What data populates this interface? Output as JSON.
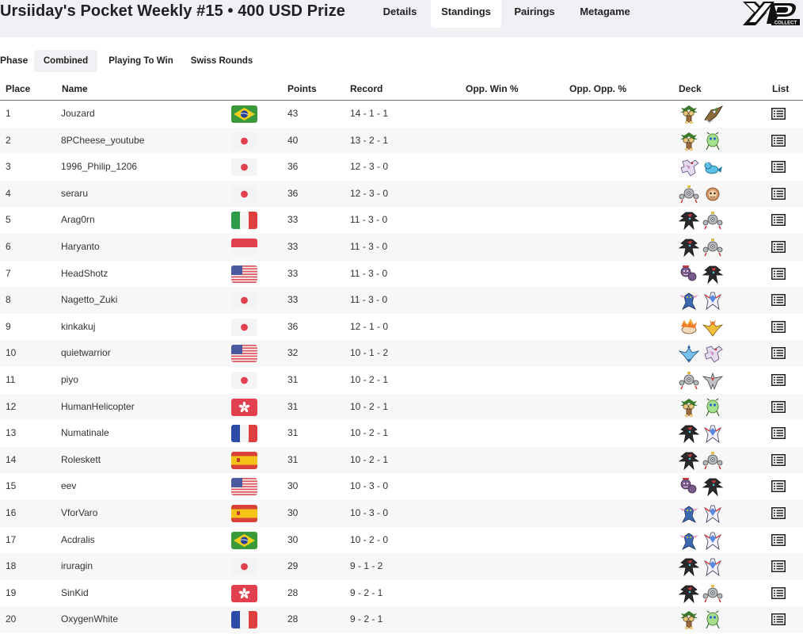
{
  "header": {
    "title": "Ursiiday's Pocket Weekly #15 • 400 USD Prize",
    "tabs": [
      {
        "label": "Details",
        "active": false
      },
      {
        "label": "Standings",
        "active": true
      },
      {
        "label": "Pairings",
        "active": false
      },
      {
        "label": "Metagame",
        "active": false
      }
    ],
    "logo_icon": "xp-collect-logo"
  },
  "phase": {
    "label": "Phase",
    "tabs": [
      {
        "label": "Combined",
        "active": true
      },
      {
        "label": "Playing To Win",
        "active": false
      },
      {
        "label": "Swiss Rounds",
        "active": false
      }
    ]
  },
  "table": {
    "columns": [
      "Place",
      "Name",
      "Points",
      "Record",
      "Opp. Win %",
      "Opp. Opp. %",
      "Deck",
      "List"
    ],
    "rows": [
      {
        "place": "1",
        "name": "Jouzard",
        "flag": "brazil",
        "points": "43",
        "record": "14 - 1 - 1",
        "deck": [
          "exeggutor-icon",
          "decidueye-icon"
        ]
      },
      {
        "place": "2",
        "name": "8PCheese_youtube",
        "flag": "japan",
        "points": "40",
        "record": "13 - 2 - 1",
        "deck": [
          "exeggutor-icon",
          "celebi-icon"
        ]
      },
      {
        "place": "3",
        "name": "1996_Philip_1206",
        "flag": "japan",
        "points": "36",
        "record": "12 - 3 - 0",
        "deck": [
          "palkia-icon",
          "vaporeon-icon"
        ]
      },
      {
        "place": "4",
        "name": "seraru",
        "flag": "japan",
        "points": "36",
        "record": "12 - 3 - 0",
        "deck": [
          "magnezone-icon",
          "primeape-icon"
        ]
      },
      {
        "place": "5",
        "name": "Arag0rn",
        "flag": "italy",
        "points": "33",
        "record": "11 - 3 - 0",
        "deck": [
          "darkrai-icon",
          "magnezone-icon"
        ]
      },
      {
        "place": "6",
        "name": "Haryanto",
        "flag": "indonesia",
        "points": "33",
        "record": "11 - 3 - 0",
        "deck": [
          "darkrai-icon",
          "magnezone-icon"
        ]
      },
      {
        "place": "7",
        "name": "HeadShotz",
        "flag": "usa",
        "points": "33",
        "record": "11 - 3 - 0",
        "deck": [
          "weezing-icon",
          "darkrai-icon"
        ]
      },
      {
        "place": "8",
        "name": "Nagetto_Zuki",
        "flag": "japan",
        "points": "33",
        "record": "11 - 3 - 0",
        "deck": [
          "greninja-icon",
          "gallade-icon"
        ]
      },
      {
        "place": "9",
        "name": "kinkakuj",
        "flag": "japan",
        "points": "36",
        "record": "12 - 1 - 0",
        "deck": [
          "rapidash-icon",
          "moltres-icon"
        ]
      },
      {
        "place": "10",
        "name": "quietwarrior",
        "flag": "usa",
        "points": "32",
        "record": "10 - 1 - 2",
        "deck": [
          "articuno-icon",
          "palkia-icon"
        ]
      },
      {
        "place": "11",
        "name": "piyo",
        "flag": "japan",
        "points": "31",
        "record": "10 - 2 - 1",
        "deck": [
          "magnezone-icon",
          "skarmory-icon"
        ]
      },
      {
        "place": "12",
        "name": "HumanHelicopter",
        "flag": "hongkong",
        "points": "31",
        "record": "10 - 2 - 1",
        "deck": [
          "exeggutor-icon",
          "celebi-icon"
        ]
      },
      {
        "place": "13",
        "name": "Numatinale",
        "flag": "france",
        "points": "31",
        "record": "10 - 2 - 1",
        "deck": [
          "darkrai-icon",
          "gallade-icon"
        ]
      },
      {
        "place": "14",
        "name": "Roleskett",
        "flag": "spain",
        "points": "31",
        "record": "10 - 2 - 1",
        "deck": [
          "darkrai-icon",
          "magnezone-icon"
        ]
      },
      {
        "place": "15",
        "name": "eev",
        "flag": "usa",
        "points": "30",
        "record": "10 - 3 - 0",
        "deck": [
          "weezing-icon",
          "darkrai-icon"
        ]
      },
      {
        "place": "16",
        "name": "VforVaro",
        "flag": "spain",
        "points": "30",
        "record": "10 - 3 - 0",
        "deck": [
          "greninja-icon",
          "gallade-icon"
        ]
      },
      {
        "place": "17",
        "name": "Acdralis",
        "flag": "brazil",
        "points": "30",
        "record": "10 - 2 - 0",
        "deck": [
          "greninja-icon",
          "gallade-icon"
        ]
      },
      {
        "place": "18",
        "name": "iruragin",
        "flag": "japan",
        "points": "29",
        "record": "9 - 1 - 2",
        "deck": [
          "darkrai-icon",
          "gallade-icon"
        ]
      },
      {
        "place": "19",
        "name": "SinKid",
        "flag": "hongkong",
        "points": "28",
        "record": "9 - 2 - 1",
        "deck": [
          "darkrai-icon",
          "magnezone-icon"
        ]
      },
      {
        "place": "20",
        "name": "OxygenWhite",
        "flag": "france",
        "points": "28",
        "record": "9 - 2 - 1",
        "deck": [
          "exeggutor-icon",
          "celebi-icon"
        ]
      }
    ]
  }
}
